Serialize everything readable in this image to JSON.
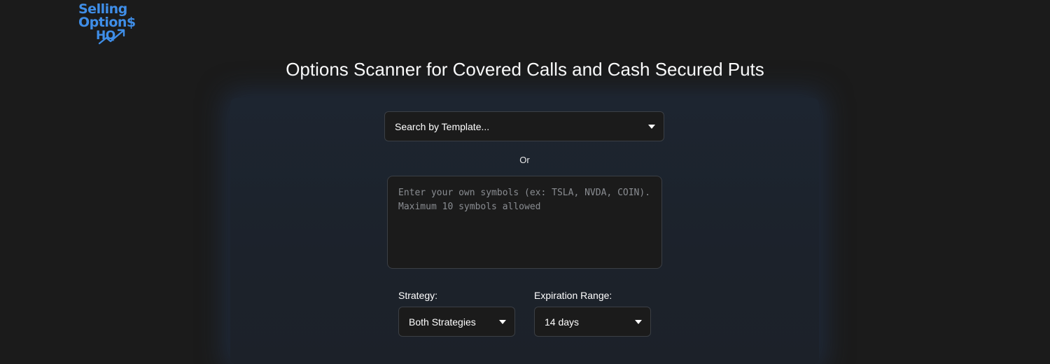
{
  "brand": {
    "logo_line1": "Selling",
    "logo_line2": "Option$",
    "logo_line3": "HQ",
    "logo_color": "#3f8ee8"
  },
  "page": {
    "title": "Options Scanner for Covered Calls and Cash Secured Puts"
  },
  "scanner": {
    "template_select": {
      "value": "Search by Template...",
      "icon": "caret-down-icon"
    },
    "or_label": "Or",
    "symbols_input": {
      "value": "",
      "placeholder": "Enter your own symbols (ex: TSLA, NVDA, COIN). Maximum 10 symbols allowed"
    },
    "strategy": {
      "label": "Strategy:",
      "value": "Both Strategies",
      "icon": "caret-down-icon"
    },
    "expiration": {
      "label": "Expiration Range:",
      "value": "14 days",
      "icon": "caret-down-icon"
    }
  },
  "colors": {
    "background": "#1b1b1b",
    "card": "#1d2530",
    "input_border": "#3b3f45",
    "accent": "#3f8ee8"
  }
}
